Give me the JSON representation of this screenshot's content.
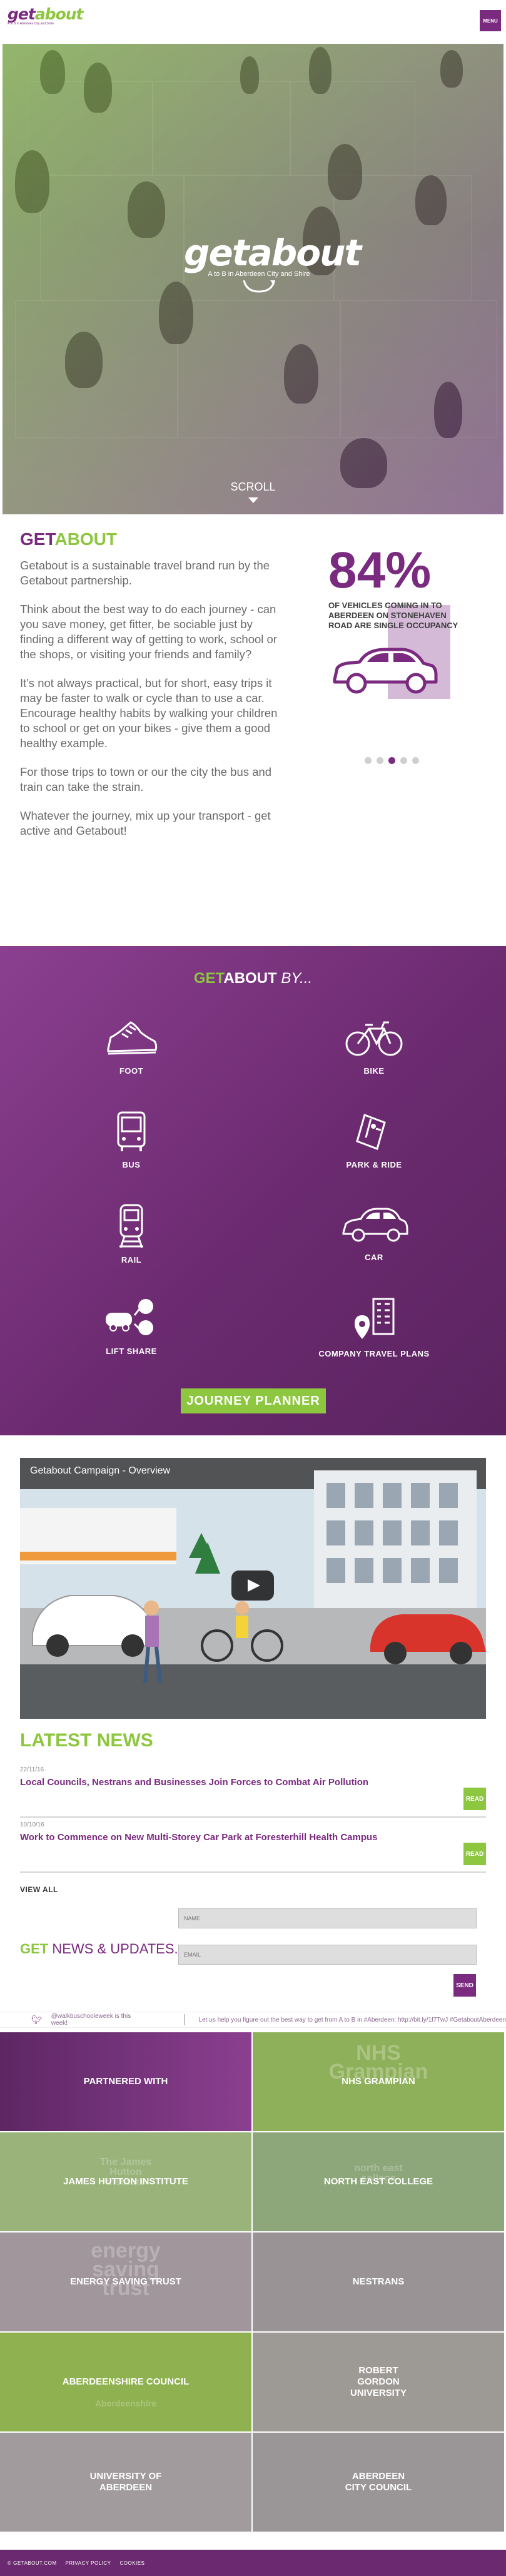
{
  "header": {
    "logo_text_get": "get",
    "logo_text_about": "about",
    "logo_tagline": "A to B in Aberdeen City and Shire",
    "menu_label": "MENU"
  },
  "hero": {
    "logo_text": "getabout",
    "tagline": "A to B in Aberdeen City and Shire",
    "scroll_label": "SCROLL"
  },
  "about": {
    "heading_part1": "GET",
    "heading_part2": "ABOUT",
    "paragraphs": [
      "Getabout is a sustainable travel brand run by the Getabout partnership.",
      "Think about the best way to do each journey - can you save money, get fitter, be sociable just by finding a different way of getting to work, school or the shops, or visiting your friends and family?",
      "It's not always practical, but for short, easy trips it may be faster to walk or cycle than to use a car. Encourage healthy habits by walking your children to school or get on your bikes - give them a good healthy example.",
      "For those trips to town or our the city the bus and train can take the strain.",
      "Whatever the journey, mix up your transport - get active and Getabout!"
    ],
    "stat": {
      "value": "84%",
      "caption": "OF VEHICLES COMING IN TO ABERDEEN ON STONEHAVEN ROAD ARE SINGLE OCCUPANCY"
    },
    "carousel": {
      "count": 5,
      "active_index": 2
    }
  },
  "by": {
    "heading_get": "GET",
    "heading_about": "ABOUT",
    "heading_by": " BY...",
    "modes": [
      {
        "label": "FOOT",
        "icon": "shoe-icon"
      },
      {
        "label": "BIKE",
        "icon": "bike-icon"
      },
      {
        "label": "BUS",
        "icon": "bus-icon"
      },
      {
        "label": "PARK & RIDE",
        "icon": "ticket-icon"
      },
      {
        "label": "RAIL",
        "icon": "train-icon"
      },
      {
        "label": "CAR",
        "icon": "car-icon"
      },
      {
        "label": "LIFT SHARE",
        "icon": "lift-share-icon"
      },
      {
        "label": "COMPANY TRAVEL PLANS",
        "icon": "building-icon"
      }
    ],
    "journey_planner_label": "JOURNEY PLANNER"
  },
  "video": {
    "title": "Getabout Campaign - Overview"
  },
  "news": {
    "heading": "LATEST NEWS",
    "items": [
      {
        "date": "22/11/16",
        "title": "Local Councils, Nestrans and Businesses Join Forces to Combat Air Pollution",
        "read_label": "READ"
      },
      {
        "date": "10/10/16",
        "title": "Work to Commence on New Multi-Storey Car Park at Foresterhill Health Campus",
        "read_label": "READ"
      }
    ],
    "view_all_label": "VIEW ALL"
  },
  "signup": {
    "heading_get": "GET",
    "heading_rest": " NEWS & UPDATES...",
    "name_placeholder": "NAME",
    "email_placeholder": "EMAIL",
    "send_label": "SEND"
  },
  "twitter": {
    "handle_text": "@walkbuschooleweek is this week!",
    "tweet_text": "Let us help you figure out the best way to get from A to B in #Aberdeen: http://bit.ly/1f7TwJ #GetaboutAberdeen"
  },
  "partners": {
    "tiles": [
      {
        "label": "PARTNERED WITH",
        "ghost": ""
      },
      {
        "label": "NHS GRAMPIAN",
        "ghost": "NHS\nGrampian"
      },
      {
        "label": "JAMES HUTTON INSTITUTE",
        "ghost": "The James\nHutton\nInstitute"
      },
      {
        "label": "NORTH EAST COLLEGE",
        "ghost": "north east\ncollege"
      },
      {
        "label": "ENERGY SAVING TRUST",
        "ghost": "energy\nsaving\ntrust"
      },
      {
        "label": "NESTRANS",
        "ghost": ""
      },
      {
        "label": "ABERDEENSHIRE COUNCIL",
        "ghost": "Aberdeenshire"
      },
      {
        "label": "ROBERT GORDON UNIVERSITY",
        "ghost": ""
      },
      {
        "label": "UNIVERSITY OF ABERDEEN",
        "ghost": ""
      },
      {
        "label": "ABERDEEN CITY COUNCIL",
        "ghost": ""
      }
    ]
  },
  "footer": {
    "links": [
      "© GETABOUT.COM",
      "PRIVACY POLICY",
      "COOKIES"
    ]
  },
  "colors": {
    "purple": "#7a2a7f",
    "green": "#8dc63f"
  }
}
